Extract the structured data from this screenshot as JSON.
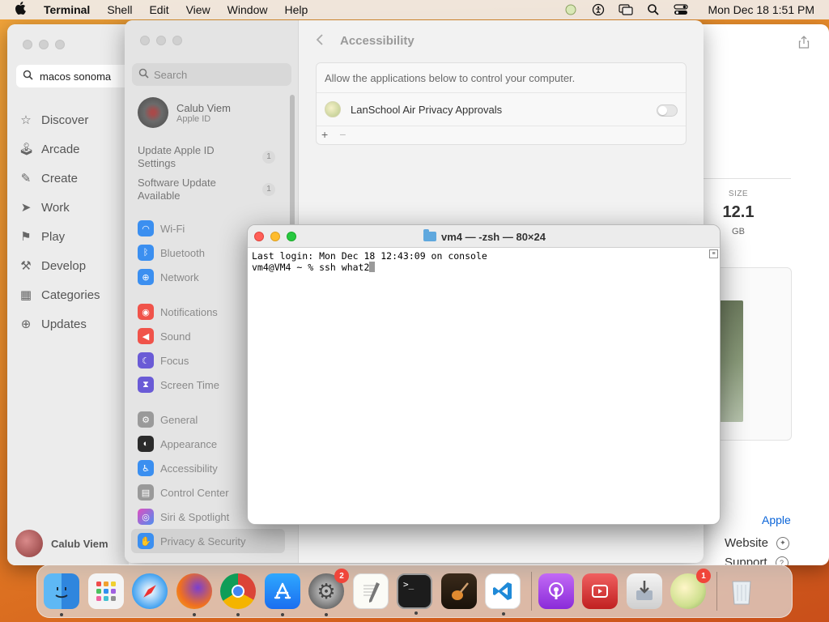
{
  "menubar": {
    "app_name": "Terminal",
    "items": [
      "Shell",
      "Edit",
      "View",
      "Window",
      "Help"
    ],
    "clock": "Mon Dec 18  1:51 PM"
  },
  "appstore": {
    "search_value": "macos sonoma",
    "nav": [
      {
        "label": "Discover",
        "icon": "star-icon"
      },
      {
        "label": "Arcade",
        "icon": "arcade-icon"
      },
      {
        "label": "Create",
        "icon": "brush-icon"
      },
      {
        "label": "Work",
        "icon": "paperplane-icon"
      },
      {
        "label": "Play",
        "icon": "rocket-icon"
      },
      {
        "label": "Develop",
        "icon": "hammer-icon"
      },
      {
        "label": "Categories",
        "icon": "grid-icon"
      },
      {
        "label": "Updates",
        "icon": "download-icon"
      }
    ],
    "user_name": "Calub Viem",
    "size_label": "SIZE",
    "size_value": "12.1",
    "size_unit": "GB",
    "developer_link": "Apple",
    "website_label": "Website",
    "support_label": "Support"
  },
  "settings": {
    "search_placeholder": "Search",
    "profile_name": "Calub Viem",
    "profile_sub": "Apple ID",
    "update_apple_id": "Update Apple ID Settings",
    "update_apple_id_count": "1",
    "software_update": "Software Update Available",
    "software_update_count": "1",
    "group1": [
      {
        "label": "Wi-Fi",
        "color": "#3b8ff0",
        "icon": "wifi-icon"
      },
      {
        "label": "Bluetooth",
        "color": "#3b8ff0",
        "icon": "bluetooth-icon"
      },
      {
        "label": "Network",
        "color": "#3b8ff0",
        "icon": "globe-icon"
      }
    ],
    "group2": [
      {
        "label": "Notifications",
        "color": "#f0534a",
        "icon": "bell-icon"
      },
      {
        "label": "Sound",
        "color": "#f0534a",
        "icon": "speaker-icon"
      },
      {
        "label": "Focus",
        "color": "#6a5bd6",
        "icon": "moon-icon"
      },
      {
        "label": "Screen Time",
        "color": "#6a5bd6",
        "icon": "hourglass-icon"
      }
    ],
    "group3": [
      {
        "label": "General",
        "color": "#9a9a9a",
        "icon": "gear-icon"
      },
      {
        "label": "Appearance",
        "color": "#2b2b2b",
        "icon": "appearance-icon"
      },
      {
        "label": "Accessibility",
        "color": "#3b8ff0",
        "icon": "accessibility-icon"
      },
      {
        "label": "Control Center",
        "color": "#9a9a9a",
        "icon": "control-center-icon"
      },
      {
        "label": "Siri & Spotlight",
        "color": "#c04ee0",
        "icon": "siri-icon"
      },
      {
        "label": "Privacy & Security",
        "color": "#3b8ff0",
        "icon": "hand-icon"
      }
    ],
    "detail_title": "Accessibility",
    "detail_desc": "Allow the applications below to control your computer.",
    "app_row_label": "LanSchool Air Privacy Approvals",
    "add_symbol": "+",
    "remove_symbol": "−"
  },
  "terminal": {
    "title": "vm4 — -zsh — 80×24",
    "line1": "Last login: Mon Dec 18 12:43:09 on console",
    "line2": "vm4@VM4 ~ % ssh what2"
  },
  "dock": [
    {
      "name": "finder",
      "badge": ""
    },
    {
      "name": "launchpad",
      "badge": ""
    },
    {
      "name": "safari",
      "badge": ""
    },
    {
      "name": "firefox",
      "badge": ""
    },
    {
      "name": "chrome",
      "badge": ""
    },
    {
      "name": "app-store",
      "badge": ""
    },
    {
      "name": "system-settings",
      "badge": "2"
    },
    {
      "name": "textedit",
      "badge": ""
    },
    {
      "name": "terminal",
      "badge": ""
    },
    {
      "name": "garageband",
      "badge": ""
    },
    {
      "name": "vscode",
      "badge": ""
    },
    {
      "name": "podcasts",
      "badge": ""
    },
    {
      "name": "photo-booth",
      "badge": ""
    },
    {
      "name": "installer",
      "badge": ""
    },
    {
      "name": "lanschool",
      "badge": "1"
    },
    {
      "name": "trash",
      "badge": ""
    }
  ]
}
